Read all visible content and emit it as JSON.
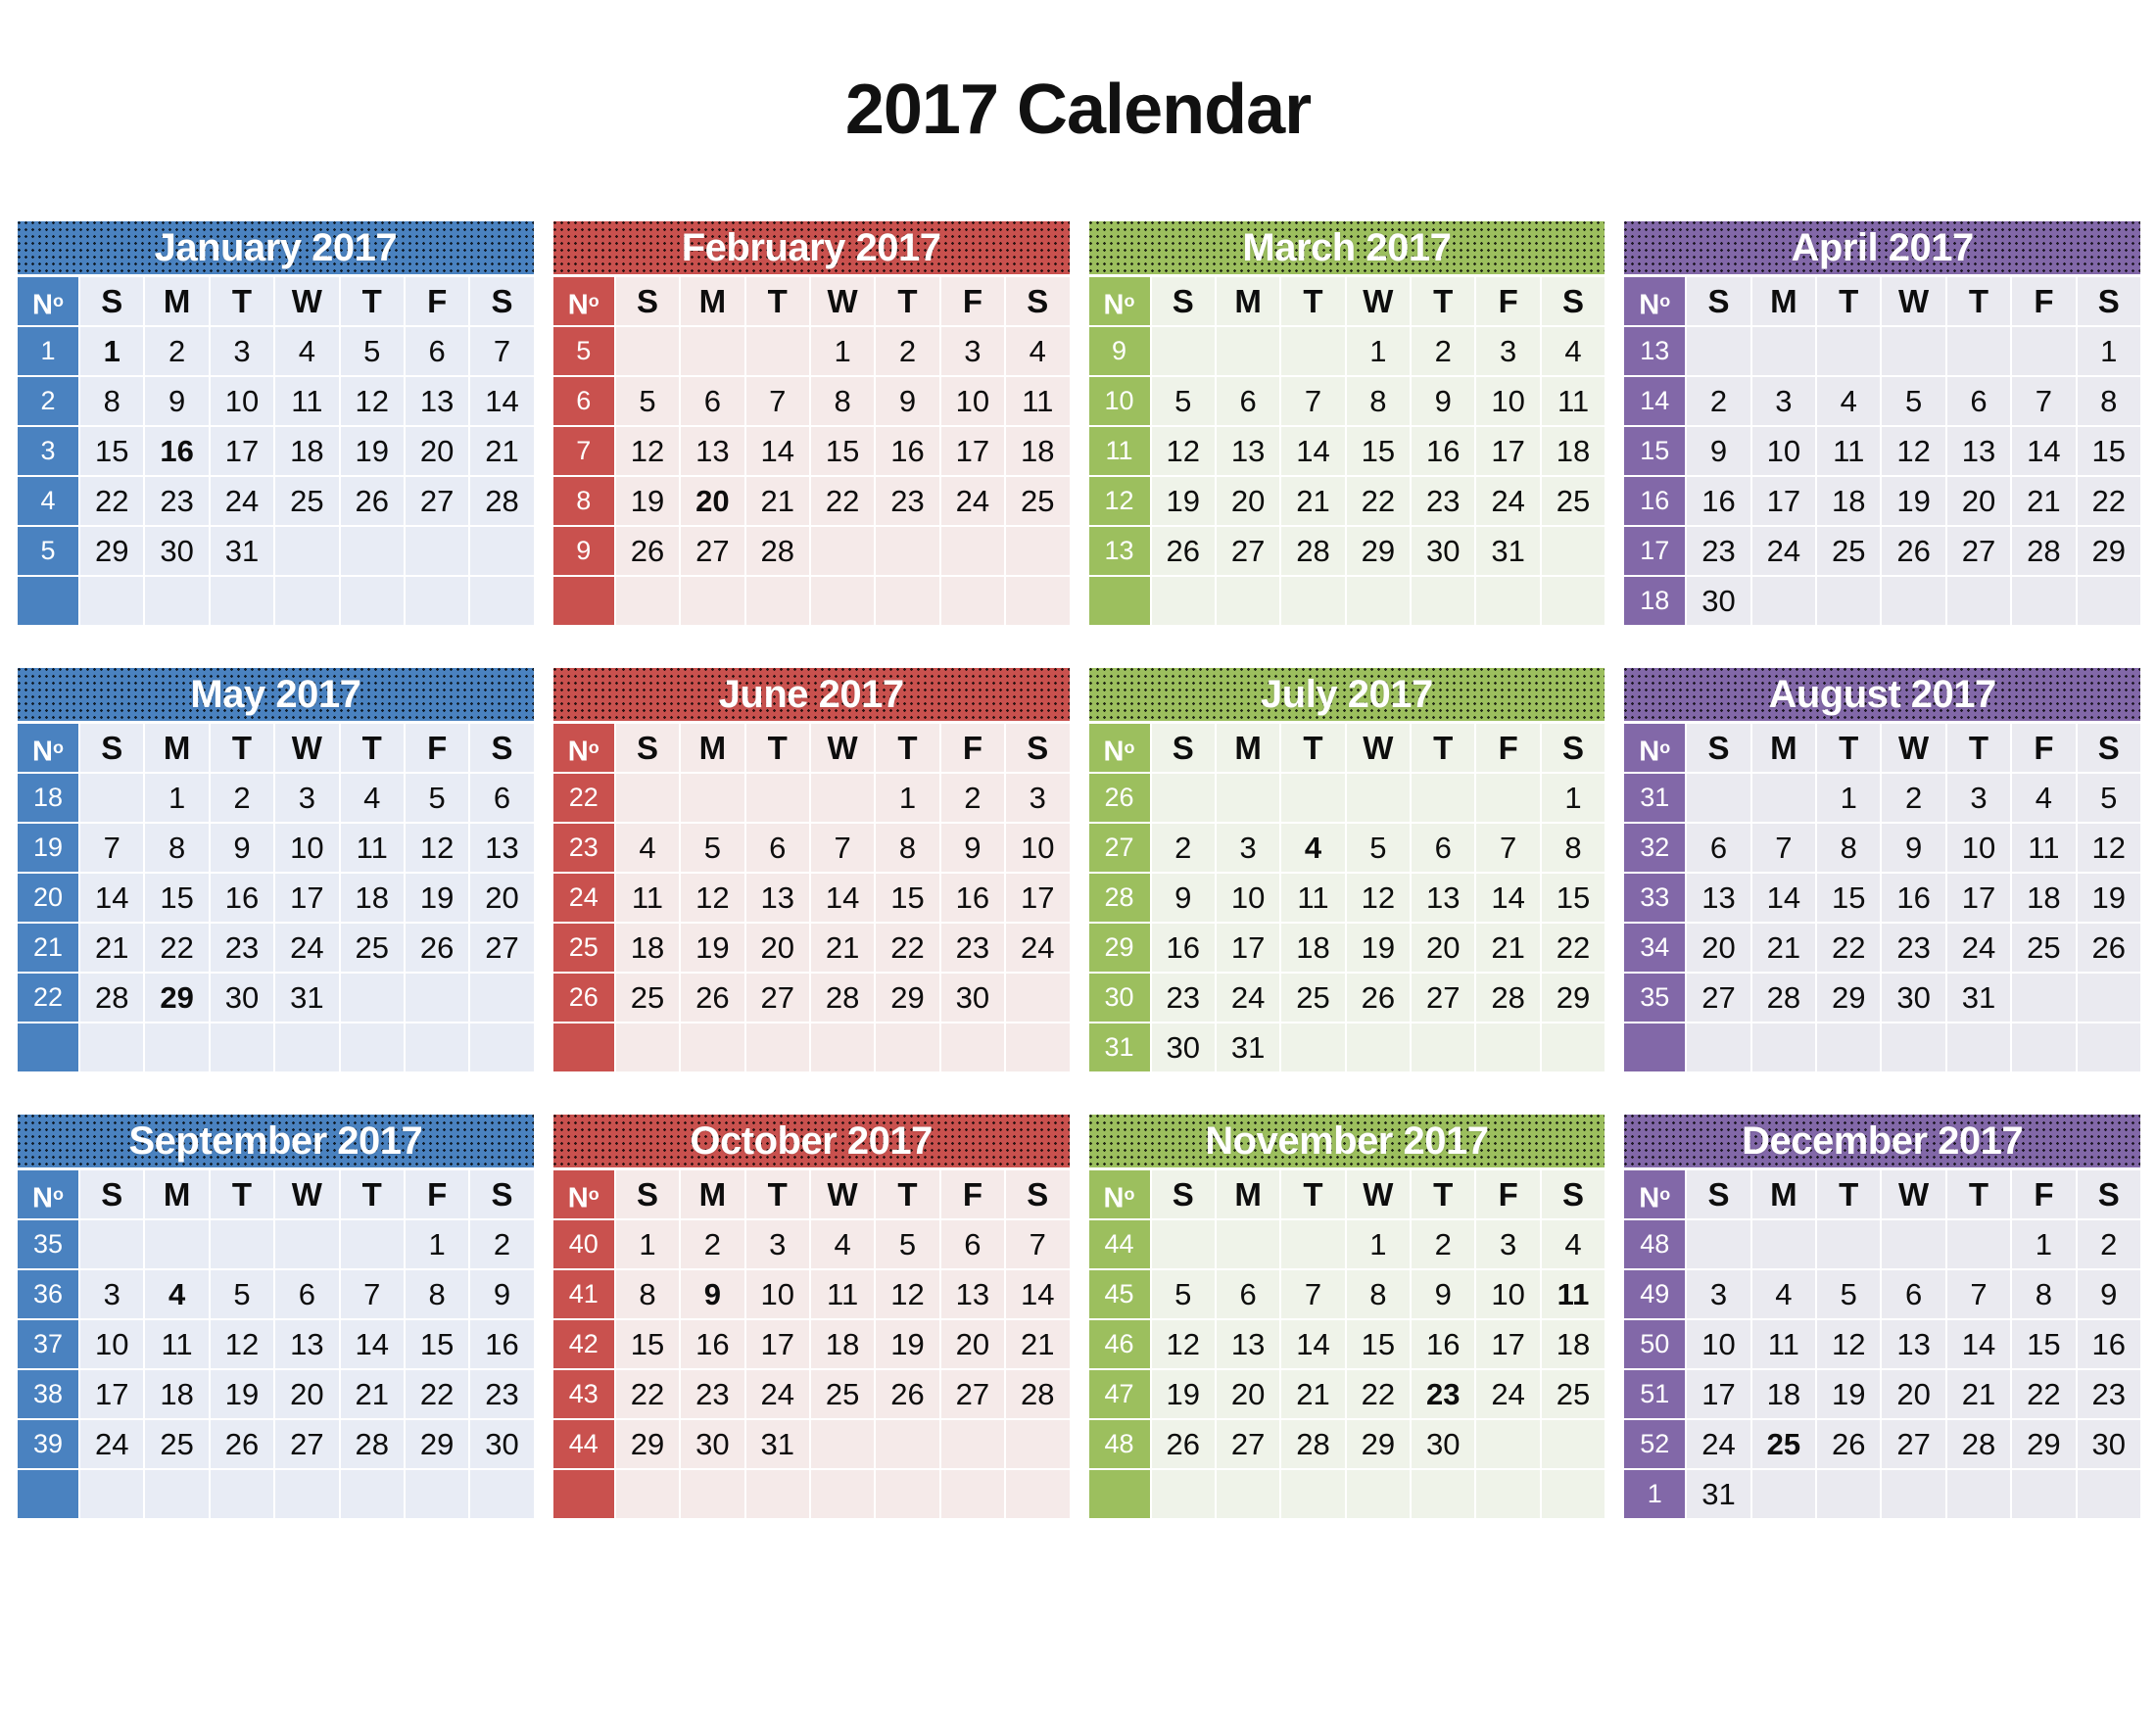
{
  "title": "2017 Calendar",
  "week_number_header": "N",
  "week_number_header_sup": "o",
  "day_headers": [
    "S",
    "M",
    "T",
    "W",
    "T",
    "F",
    "S"
  ],
  "colors": {
    "blue": "#4a82c0",
    "blue_cell": "#e8ecf5",
    "red": "#c9514e",
    "red_cell": "#f5eae9",
    "green": "#9cbf5e",
    "green_cell": "#eff3e9",
    "purple": "#8268a8",
    "purple_cell": "#eaeaf0",
    "title": "#111111"
  },
  "months": [
    {
      "name": "January 2017",
      "theme": "blue",
      "week_numbers": [
        "1",
        "2",
        "3",
        "4",
        "5",
        ""
      ],
      "weeks": [
        [
          "1",
          "2",
          "3",
          "4",
          "5",
          "6",
          "7"
        ],
        [
          "8",
          "9",
          "10",
          "11",
          "12",
          "13",
          "14"
        ],
        [
          "15",
          "16",
          "17",
          "18",
          "19",
          "20",
          "21"
        ],
        [
          "22",
          "23",
          "24",
          "25",
          "26",
          "27",
          "28"
        ],
        [
          "29",
          "30",
          "31",
          "",
          "",
          "",
          ""
        ],
        [
          "",
          "",
          "",
          "",
          "",
          "",
          ""
        ]
      ],
      "bold_days": [
        "1",
        "16"
      ]
    },
    {
      "name": "February 2017",
      "theme": "red",
      "week_numbers": [
        "5",
        "6",
        "7",
        "8",
        "9",
        ""
      ],
      "weeks": [
        [
          "",
          "",
          "",
          "1",
          "2",
          "3",
          "4"
        ],
        [
          "5",
          "6",
          "7",
          "8",
          "9",
          "10",
          "11"
        ],
        [
          "12",
          "13",
          "14",
          "15",
          "16",
          "17",
          "18"
        ],
        [
          "19",
          "20",
          "21",
          "22",
          "23",
          "24",
          "25"
        ],
        [
          "26",
          "27",
          "28",
          "",
          "",
          "",
          ""
        ],
        [
          "",
          "",
          "",
          "",
          "",
          "",
          ""
        ]
      ],
      "bold_days": [
        "20"
      ]
    },
    {
      "name": "March 2017",
      "theme": "green",
      "week_numbers": [
        "9",
        "10",
        "11",
        "12",
        "13",
        ""
      ],
      "weeks": [
        [
          "",
          "",
          "",
          "1",
          "2",
          "3",
          "4"
        ],
        [
          "5",
          "6",
          "7",
          "8",
          "9",
          "10",
          "11"
        ],
        [
          "12",
          "13",
          "14",
          "15",
          "16",
          "17",
          "18"
        ],
        [
          "19",
          "20",
          "21",
          "22",
          "23",
          "24",
          "25"
        ],
        [
          "26",
          "27",
          "28",
          "29",
          "30",
          "31",
          ""
        ],
        [
          "",
          "",
          "",
          "",
          "",
          "",
          ""
        ]
      ],
      "bold_days": []
    },
    {
      "name": "April 2017",
      "theme": "purple",
      "week_numbers": [
        "13",
        "14",
        "15",
        "16",
        "17",
        "18"
      ],
      "weeks": [
        [
          "",
          "",
          "",
          "",
          "",
          "",
          "1"
        ],
        [
          "2",
          "3",
          "4",
          "5",
          "6",
          "7",
          "8"
        ],
        [
          "9",
          "10",
          "11",
          "12",
          "13",
          "14",
          "15"
        ],
        [
          "16",
          "17",
          "18",
          "19",
          "20",
          "21",
          "22"
        ],
        [
          "23",
          "24",
          "25",
          "26",
          "27",
          "28",
          "29"
        ],
        [
          "30",
          "",
          "",
          "",
          "",
          "",
          ""
        ]
      ],
      "bold_days": []
    },
    {
      "name": "May 2017",
      "theme": "blue",
      "week_numbers": [
        "18",
        "19",
        "20",
        "21",
        "22",
        ""
      ],
      "weeks": [
        [
          "",
          "1",
          "2",
          "3",
          "4",
          "5",
          "6"
        ],
        [
          "7",
          "8",
          "9",
          "10",
          "11",
          "12",
          "13"
        ],
        [
          "14",
          "15",
          "16",
          "17",
          "18",
          "19",
          "20"
        ],
        [
          "21",
          "22",
          "23",
          "24",
          "25",
          "26",
          "27"
        ],
        [
          "28",
          "29",
          "30",
          "31",
          "",
          "",
          ""
        ],
        [
          "",
          "",
          "",
          "",
          "",
          "",
          ""
        ]
      ],
      "bold_days": [
        "29"
      ]
    },
    {
      "name": "June 2017",
      "theme": "red",
      "week_numbers": [
        "22",
        "23",
        "24",
        "25",
        "26",
        ""
      ],
      "weeks": [
        [
          "",
          "",
          "",
          "",
          "1",
          "2",
          "3"
        ],
        [
          "4",
          "5",
          "6",
          "7",
          "8",
          "9",
          "10"
        ],
        [
          "11",
          "12",
          "13",
          "14",
          "15",
          "16",
          "17"
        ],
        [
          "18",
          "19",
          "20",
          "21",
          "22",
          "23",
          "24"
        ],
        [
          "25",
          "26",
          "27",
          "28",
          "29",
          "30",
          ""
        ],
        [
          "",
          "",
          "",
          "",
          "",
          "",
          ""
        ]
      ],
      "bold_days": []
    },
    {
      "name": "July 2017",
      "theme": "green",
      "week_numbers": [
        "26",
        "27",
        "28",
        "29",
        "30",
        "31"
      ],
      "weeks": [
        [
          "",
          "",
          "",
          "",
          "",
          "",
          "1"
        ],
        [
          "2",
          "3",
          "4",
          "5",
          "6",
          "7",
          "8"
        ],
        [
          "9",
          "10",
          "11",
          "12",
          "13",
          "14",
          "15"
        ],
        [
          "16",
          "17",
          "18",
          "19",
          "20",
          "21",
          "22"
        ],
        [
          "23",
          "24",
          "25",
          "26",
          "27",
          "28",
          "29"
        ],
        [
          "30",
          "31",
          "",
          "",
          "",
          "",
          ""
        ]
      ],
      "bold_days": [
        "4"
      ]
    },
    {
      "name": "August 2017",
      "theme": "purple",
      "week_numbers": [
        "31",
        "32",
        "33",
        "34",
        "35",
        ""
      ],
      "weeks": [
        [
          "",
          "",
          "1",
          "2",
          "3",
          "4",
          "5"
        ],
        [
          "6",
          "7",
          "8",
          "9",
          "10",
          "11",
          "12"
        ],
        [
          "13",
          "14",
          "15",
          "16",
          "17",
          "18",
          "19"
        ],
        [
          "20",
          "21",
          "22",
          "23",
          "24",
          "25",
          "26"
        ],
        [
          "27",
          "28",
          "29",
          "30",
          "31",
          "",
          ""
        ],
        [
          "",
          "",
          "",
          "",
          "",
          "",
          ""
        ]
      ],
      "bold_days": []
    },
    {
      "name": "September 2017",
      "theme": "blue",
      "week_numbers": [
        "35",
        "36",
        "37",
        "38",
        "39",
        ""
      ],
      "weeks": [
        [
          "",
          "",
          "",
          "",
          "",
          "1",
          "2"
        ],
        [
          "3",
          "4",
          "5",
          "6",
          "7",
          "8",
          "9"
        ],
        [
          "10",
          "11",
          "12",
          "13",
          "14",
          "15",
          "16"
        ],
        [
          "17",
          "18",
          "19",
          "20",
          "21",
          "22",
          "23"
        ],
        [
          "24",
          "25",
          "26",
          "27",
          "28",
          "29",
          "30"
        ],
        [
          "",
          "",
          "",
          "",
          "",
          "",
          ""
        ]
      ],
      "bold_days": [
        "4"
      ]
    },
    {
      "name": "October 2017",
      "theme": "red",
      "week_numbers": [
        "40",
        "41",
        "42",
        "43",
        "44",
        ""
      ],
      "weeks": [
        [
          "1",
          "2",
          "3",
          "4",
          "5",
          "6",
          "7"
        ],
        [
          "8",
          "9",
          "10",
          "11",
          "12",
          "13",
          "14"
        ],
        [
          "15",
          "16",
          "17",
          "18",
          "19",
          "20",
          "21"
        ],
        [
          "22",
          "23",
          "24",
          "25",
          "26",
          "27",
          "28"
        ],
        [
          "29",
          "30",
          "31",
          "",
          "",
          "",
          ""
        ],
        [
          "",
          "",
          "",
          "",
          "",
          "",
          ""
        ]
      ],
      "bold_days": [
        "9"
      ]
    },
    {
      "name": "November 2017",
      "theme": "green",
      "week_numbers": [
        "44",
        "45",
        "46",
        "47",
        "48",
        ""
      ],
      "weeks": [
        [
          "",
          "",
          "",
          "1",
          "2",
          "3",
          "4"
        ],
        [
          "5",
          "6",
          "7",
          "8",
          "9",
          "10",
          "11"
        ],
        [
          "12",
          "13",
          "14",
          "15",
          "16",
          "17",
          "18"
        ],
        [
          "19",
          "20",
          "21",
          "22",
          "23",
          "24",
          "25"
        ],
        [
          "26",
          "27",
          "28",
          "29",
          "30",
          "",
          ""
        ],
        [
          "",
          "",
          "",
          "",
          "",
          "",
          ""
        ]
      ],
      "bold_days": [
        "11",
        "23"
      ]
    },
    {
      "name": "December 2017",
      "theme": "purple",
      "week_numbers": [
        "48",
        "49",
        "50",
        "51",
        "52",
        "1"
      ],
      "weeks": [
        [
          "",
          "",
          "",
          "",
          "",
          "1",
          "2"
        ],
        [
          "3",
          "4",
          "5",
          "6",
          "7",
          "8",
          "9"
        ],
        [
          "10",
          "11",
          "12",
          "13",
          "14",
          "15",
          "16"
        ],
        [
          "17",
          "18",
          "19",
          "20",
          "21",
          "22",
          "23"
        ],
        [
          "24",
          "25",
          "26",
          "27",
          "28",
          "29",
          "30"
        ],
        [
          "31",
          "",
          "",
          "",
          "",
          "",
          ""
        ]
      ],
      "bold_days": [
        "25"
      ]
    }
  ]
}
